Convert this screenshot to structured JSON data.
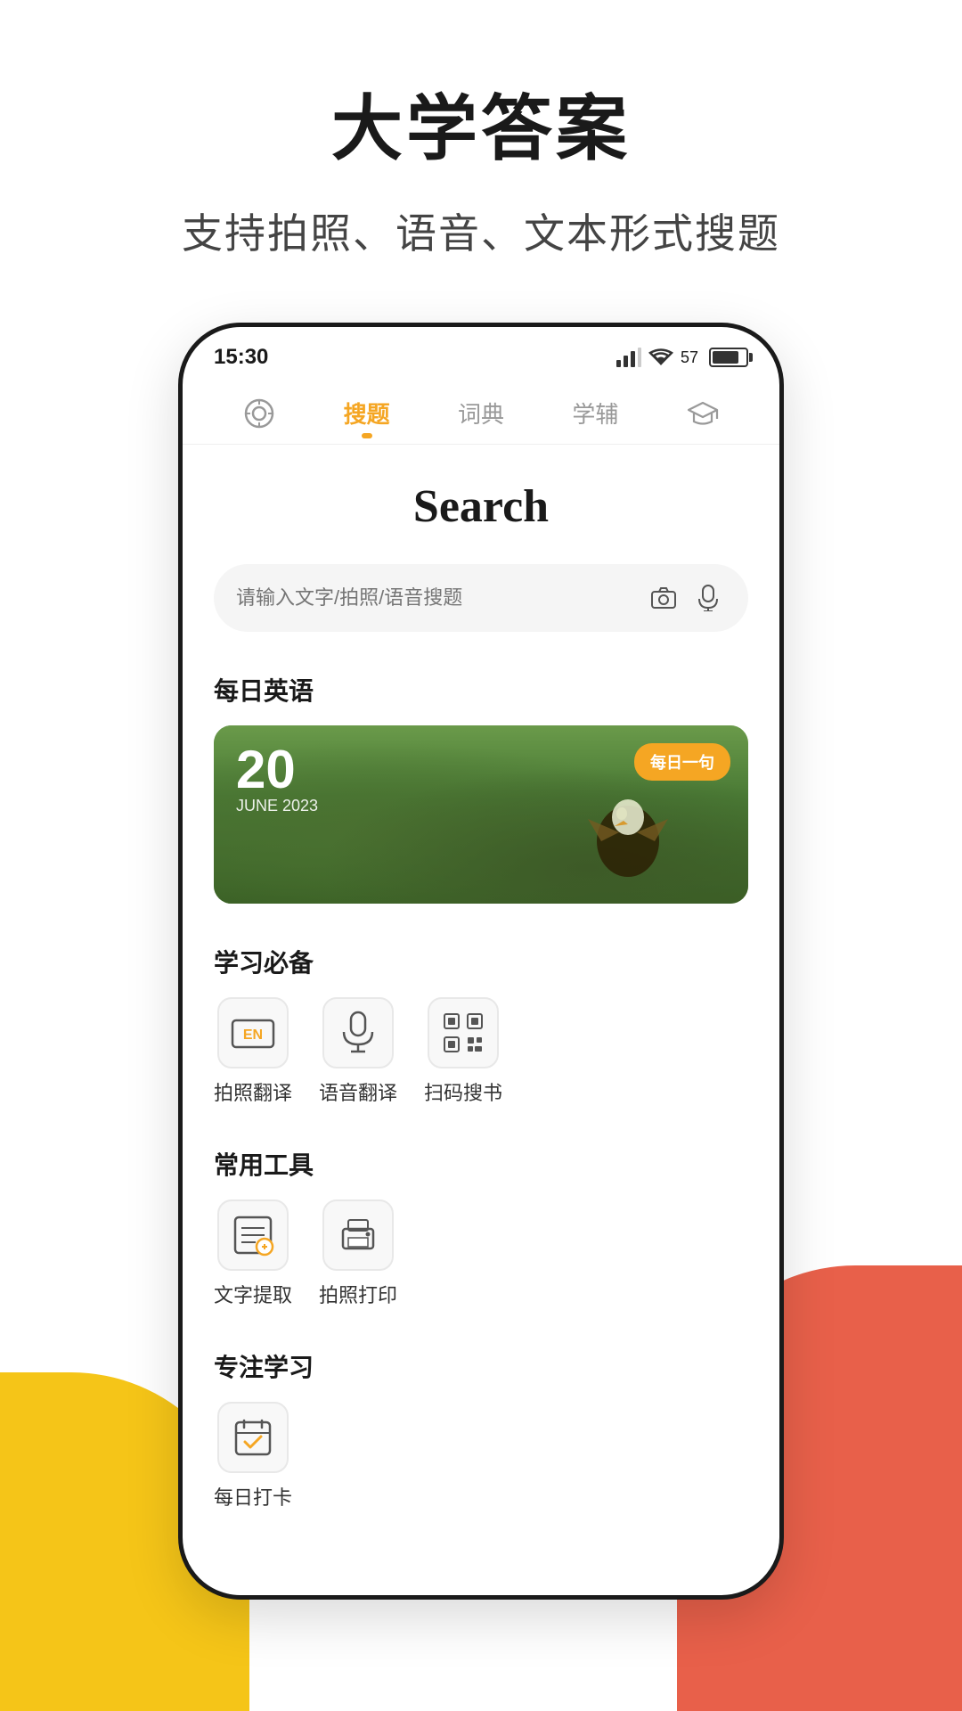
{
  "page": {
    "title": "大学答案",
    "subtitle": "支持拍照、语音、文本形式搜题"
  },
  "status_bar": {
    "time": "15:30",
    "battery": "57"
  },
  "nav": {
    "items": [
      {
        "id": "camera",
        "label": "",
        "icon": "⊙",
        "active": false
      },
      {
        "id": "search",
        "label": "搜题",
        "icon": "",
        "active": true
      },
      {
        "id": "dict",
        "label": "词典",
        "icon": "",
        "active": false
      },
      {
        "id": "tutor",
        "label": "学辅",
        "icon": "",
        "active": false
      },
      {
        "id": "graduate",
        "label": "",
        "icon": "🎓",
        "active": false
      }
    ]
  },
  "search_page": {
    "title": "Search",
    "search_placeholder": "请输入文字/拍照/语音搜题"
  },
  "daily_english": {
    "section_title": "每日英语",
    "date_num": "20",
    "date_sub": "JUNE  2023",
    "badge": "每日一句"
  },
  "study_tools": {
    "section_title": "学习必备",
    "items": [
      {
        "id": "photo-translate",
        "label": "拍照翻译",
        "icon": "EN"
      },
      {
        "id": "voice-translate",
        "label": "语音翻译",
        "icon": "🎙"
      },
      {
        "id": "scan-search",
        "label": "扫码搜书",
        "icon": "⊞"
      }
    ]
  },
  "common_tools": {
    "section_title": "常用工具",
    "items": [
      {
        "id": "text-extract",
        "label": "文字提取",
        "icon": "⊕"
      },
      {
        "id": "photo-print",
        "label": "拍照打印",
        "icon": "🖨"
      }
    ]
  },
  "focus_study": {
    "section_title": "专注学习",
    "items": [
      {
        "id": "daily-checkin",
        "label": "每日打卡",
        "icon": "📋"
      }
    ]
  }
}
